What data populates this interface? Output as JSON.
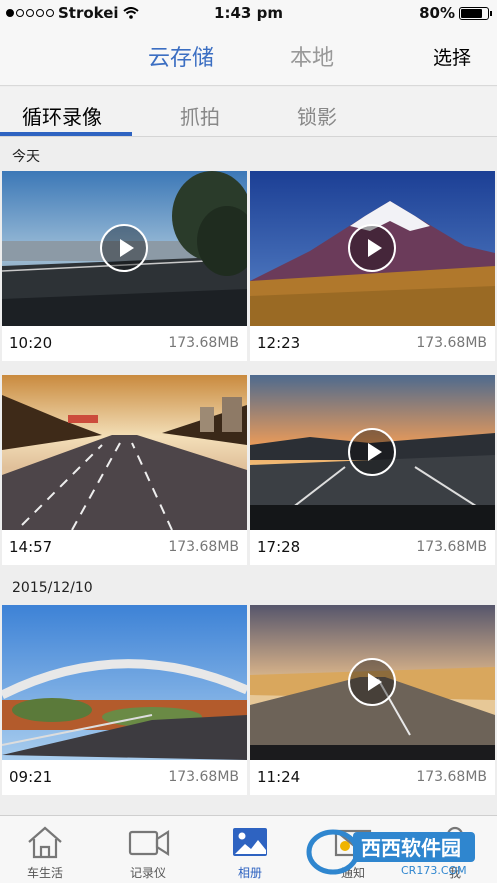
{
  "status_bar": {
    "carrier": "Strokei",
    "time": "1:43 pm",
    "battery": "80%"
  },
  "nav": {
    "segments": [
      "云存储",
      "本地"
    ],
    "select_label": "选择"
  },
  "tabs": [
    "循环录像",
    "抓拍",
    "锁影"
  ],
  "sections": [
    {
      "header": "今天",
      "videos": [
        {
          "time": "10:20",
          "size": "173.68MB"
        },
        {
          "time": "12:23",
          "size": "173.68MB"
        },
        {
          "time": "14:57",
          "size": "173.68MB"
        },
        {
          "time": "17:28",
          "size": "173.68MB"
        }
      ]
    },
    {
      "header": "2015/12/10",
      "videos": [
        {
          "time": "09:21",
          "size": "173.68MB"
        },
        {
          "time": "11:24",
          "size": "173.68MB"
        }
      ]
    }
  ],
  "tab_bar": {
    "items": [
      "车生活",
      "记录仪",
      "相册",
      "通知",
      "我"
    ],
    "active": "相册"
  },
  "watermark": {
    "brand": "西西软件园",
    "domain": "CR173.COM"
  },
  "colors": {
    "accent": "#2e63c1",
    "nav_bg": "#f7f7f7",
    "page_bg": "#eeeeee"
  }
}
